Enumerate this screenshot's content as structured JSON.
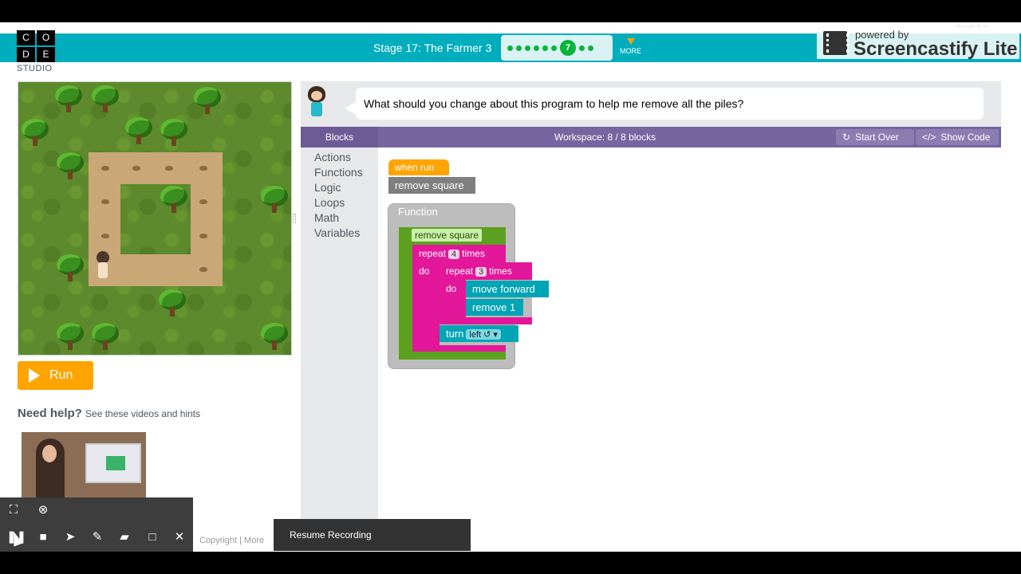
{
  "logo": {
    "letters": [
      "C",
      "O",
      "D",
      "E"
    ],
    "studio": "STUDIO"
  },
  "header": {
    "stage_title": "Stage 17: The Farmer 3",
    "current_level": "7",
    "more": "MORE"
  },
  "watermark": {
    "powered_by": "powered by",
    "brand": "Screencastify Lite",
    "report_bug": "Report Bug"
  },
  "instructions": "What should you change about this program to help me remove all the piles?",
  "run_label": "Run",
  "help": {
    "title": "Need help?",
    "subtitle": "See these videos and hints"
  },
  "toolbar": {
    "blocks_label": "Blocks",
    "workspace_label": "Workspace: 8 / 8 blocks",
    "start_over": "Start Over",
    "show_code": "Show Code"
  },
  "categories": [
    "Actions",
    "Functions",
    "Logic",
    "Loops",
    "Math",
    "Variables"
  ],
  "program": {
    "when_run": "when run",
    "call": "remove square",
    "function_label": "Function",
    "function_name": "remove square",
    "repeat_outer": {
      "word": "repeat",
      "count": "4",
      "times": "times",
      "do": "do"
    },
    "repeat_inner": {
      "word": "repeat",
      "count": "3",
      "times": "times",
      "do": "do"
    },
    "move_forward": "move forward",
    "remove_1": "remove 1",
    "turn": {
      "word": "turn",
      "dir": "left ↺ ▾"
    }
  },
  "footer": {
    "copyright": "Copyright | More"
  },
  "screencastify": {
    "resume": "Resume Recording"
  }
}
